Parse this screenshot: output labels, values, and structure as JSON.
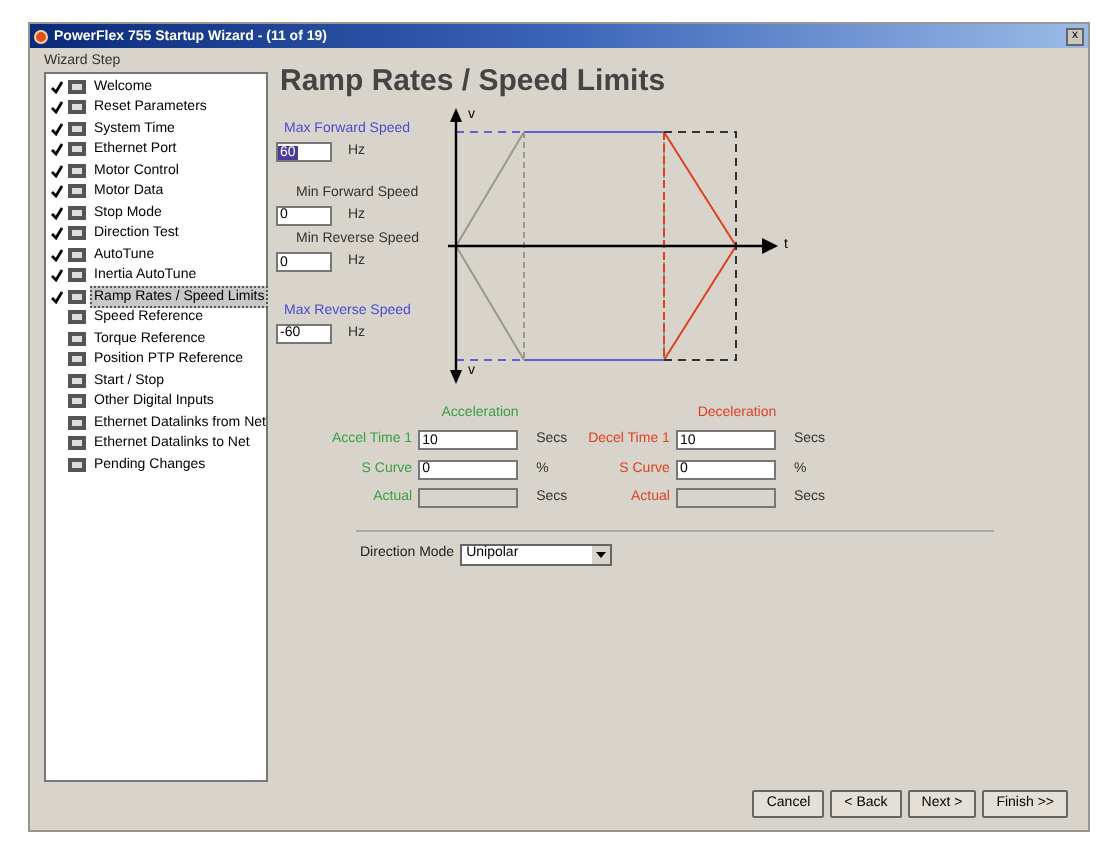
{
  "window": {
    "title": "PowerFlex 755 Startup Wizard - (11 of 19)",
    "close": "x"
  },
  "sidebar": {
    "title": "Wizard Step",
    "items": [
      {
        "label": "Welcome",
        "done": true,
        "selected": false
      },
      {
        "label": "Reset Parameters",
        "done": true,
        "selected": false
      },
      {
        "label": "System Time",
        "done": true,
        "selected": false
      },
      {
        "label": "Ethernet Port",
        "done": true,
        "selected": false
      },
      {
        "label": "Motor Control",
        "done": true,
        "selected": false
      },
      {
        "label": "Motor Data",
        "done": true,
        "selected": false
      },
      {
        "label": "Stop Mode",
        "done": true,
        "selected": false
      },
      {
        "label": "Direction Test",
        "done": true,
        "selected": false
      },
      {
        "label": "AutoTune",
        "done": true,
        "selected": false
      },
      {
        "label": "Inertia AutoTune",
        "done": true,
        "selected": false
      },
      {
        "label": "Ramp Rates / Speed Limits",
        "done": true,
        "selected": true
      },
      {
        "label": "Speed Reference",
        "done": false,
        "selected": false
      },
      {
        "label": "Torque Reference",
        "done": false,
        "selected": false
      },
      {
        "label": "Position PTP Reference",
        "done": false,
        "selected": false
      },
      {
        "label": "Start / Stop",
        "done": false,
        "selected": false
      },
      {
        "label": "Other Digital Inputs",
        "done": false,
        "selected": false
      },
      {
        "label": "Ethernet Datalinks from Net",
        "done": false,
        "selected": false
      },
      {
        "label": "Ethernet Datalinks to Net",
        "done": false,
        "selected": false
      },
      {
        "label": "Pending Changes",
        "done": false,
        "selected": false
      }
    ]
  },
  "page_title": "Ramp Rates / Speed Limits",
  "speed_limits": [
    {
      "label": "Max Forward Speed",
      "value": "60",
      "unit": "Hz",
      "color": "#4a4ad0",
      "highlighted": true
    },
    {
      "label": "Min Forward Speed",
      "value": "0",
      "unit": "Hz",
      "color": "#333333",
      "highlighted": false
    },
    {
      "label": "Min Reverse Speed",
      "value": "0",
      "unit": "Hz",
      "color": "#333333",
      "highlighted": false
    },
    {
      "label": "Max Reverse Speed",
      "value": "-60",
      "unit": "Hz",
      "color": "#4a4ad0",
      "highlighted": false
    }
  ],
  "chart_axes": {
    "y_top": "v",
    "y_bottom": "v",
    "x": "t"
  },
  "ramps": [
    {
      "heading": "Acceleration",
      "color": "#3aa040",
      "fields": [
        {
          "label": "Accel Time 1",
          "value": "10",
          "unit": "Secs",
          "disabled": false
        },
        {
          "label": "S Curve",
          "value": "0",
          "unit": "%",
          "disabled": false
        },
        {
          "label": "Actual",
          "unit": "Secs",
          "disabled": true
        }
      ]
    },
    {
      "heading": "Deceleration",
      "color": "#e04020",
      "fields": [
        {
          "label": "Decel Time 1",
          "value": "10",
          "unit": "Secs",
          "disabled": false
        },
        {
          "label": "S Curve",
          "value": "0",
          "unit": "%",
          "disabled": false
        },
        {
          "label": "Actual",
          "unit": "Secs",
          "disabled": true
        }
      ]
    }
  ],
  "direction_mode": {
    "label": "Direction Mode",
    "value": "Unipolar"
  },
  "buttons": [
    "Cancel",
    "< Back",
    "Next >",
    "Finish >>"
  ]
}
